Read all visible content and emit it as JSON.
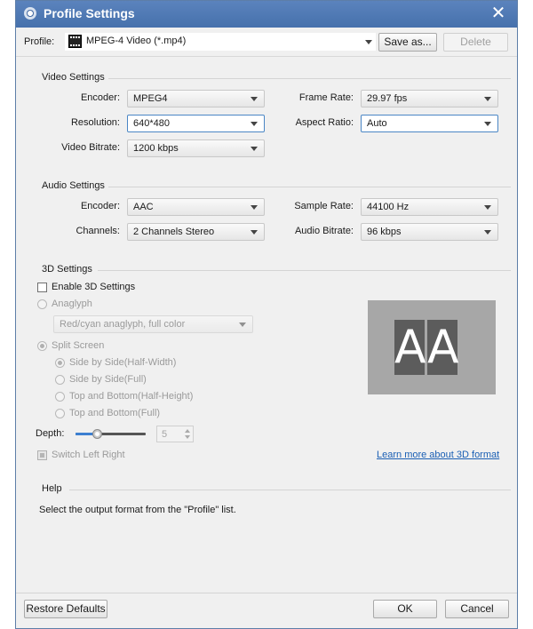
{
  "window": {
    "title": "Profile Settings"
  },
  "profile": {
    "label": "Profile:",
    "value": "MPEG-4 Video (*.mp4)",
    "save_as_label": "Save as...",
    "delete_label": "Delete"
  },
  "video": {
    "section_title": "Video Settings",
    "encoder_label": "Encoder:",
    "encoder_value": "MPEG4",
    "resolution_label": "Resolution:",
    "resolution_value": "640*480",
    "bitrate_label": "Video Bitrate:",
    "bitrate_value": "1200 kbps",
    "framerate_label": "Frame Rate:",
    "framerate_value": "29.97 fps",
    "aspect_label": "Aspect Ratio:",
    "aspect_value": "Auto"
  },
  "audio": {
    "section_title": "Audio Settings",
    "encoder_label": "Encoder:",
    "encoder_value": "AAC",
    "channels_label": "Channels:",
    "channels_value": "2 Channels Stereo",
    "samplerate_label": "Sample Rate:",
    "samplerate_value": "44100 Hz",
    "bitrate_label": "Audio Bitrate:",
    "bitrate_value": "96 kbps"
  },
  "three_d": {
    "section_title": "3D Settings",
    "enable_label": "Enable 3D Settings",
    "enabled": false,
    "anaglyph_label": "Anaglyph",
    "anaglyph_value": "Red/cyan anaglyph, full color",
    "split_screen_label": "Split Screen",
    "options": [
      {
        "label": "Side by Side(Half-Width)",
        "selected": true
      },
      {
        "label": "Side by Side(Full)",
        "selected": false
      },
      {
        "label": "Top and Bottom(Half-Height)",
        "selected": false
      },
      {
        "label": "Top and Bottom(Full)",
        "selected": false
      }
    ],
    "depth_label": "Depth:",
    "depth_value": "5",
    "depth_level": 0.3,
    "switch_label": "Switch Left Right",
    "learn_more_label": "Learn more about 3D format",
    "preview_letters": [
      "A",
      "A"
    ]
  },
  "help": {
    "section_title": "Help",
    "text": "Select the output format from the \"Profile\" list."
  },
  "footer": {
    "restore_label": "Restore Defaults",
    "ok_label": "OK",
    "cancel_label": "Cancel"
  }
}
